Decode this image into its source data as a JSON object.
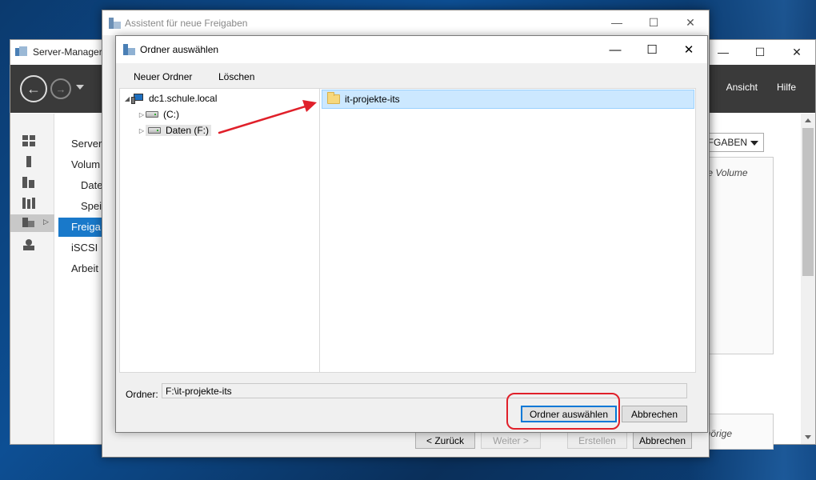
{
  "server_manager": {
    "title": "Server-Manager",
    "menu": [
      "Ansicht",
      "Hilfe"
    ],
    "nav_items": [
      "Server",
      "Volum",
      "Date",
      "Spei",
      "Freiga",
      "iSCSI",
      "Arbeit"
    ],
    "tasks_label": "UFGABEN",
    "panel1_text": "ige Volume",
    "panel2_text": "ehörige"
  },
  "wizard": {
    "title": "Assistent für neue Freigaben",
    "buttons": {
      "back": "< Zurück",
      "next": "Weiter >",
      "create": "Erstellen",
      "cancel": "Abbrechen"
    }
  },
  "dialog": {
    "title": "Ordner auswählen",
    "toolbar": {
      "new_folder": "Neuer Ordner",
      "delete": "Löschen"
    },
    "tree": {
      "root": "dc1.schule.local",
      "drives": [
        "(C:)",
        "Daten (F:)"
      ]
    },
    "files": [
      {
        "name": "it-projekte-its",
        "selected": true
      }
    ],
    "folder_label": "Ordner:",
    "folder_value": "F:\\it-projekte-its",
    "buttons": {
      "select": "Ordner auswählen",
      "cancel": "Abbrechen"
    }
  },
  "annotation_color": "#e0202a"
}
